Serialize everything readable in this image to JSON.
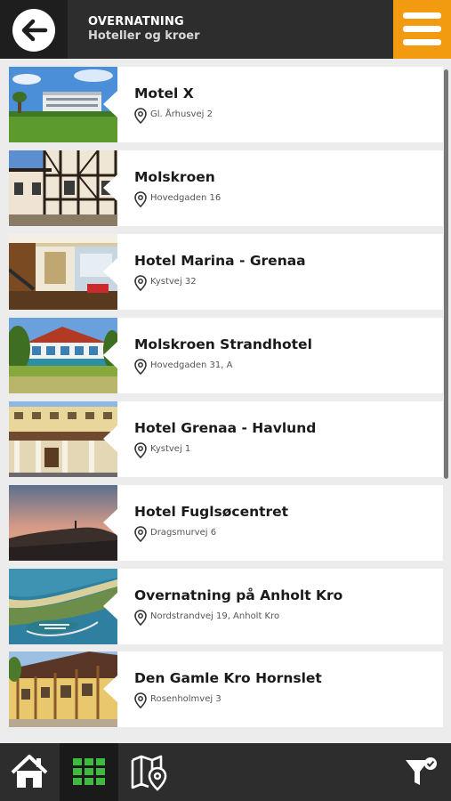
{
  "header": {
    "title": "OVERNATNING",
    "subtitle": "Hoteller og kroer",
    "back_icon": "arrow-left-icon",
    "menu_icon": "hamburger-menu-icon",
    "accent_color": "#f29b10"
  },
  "hotels": [
    {
      "name": "Motel X",
      "address": "Gl. Århusvej 2"
    },
    {
      "name": "Molskroen",
      "address": "Hovedgaden 16"
    },
    {
      "name": "Hotel Marina - Grenaa",
      "address": "Kystvej 32"
    },
    {
      "name": "Molskroen Strandhotel",
      "address": "Hovedgaden 31, A"
    },
    {
      "name": "Hotel Grenaa - Havlund",
      "address": "Kystvej 1"
    },
    {
      "name": "Hotel Fuglsøcentret",
      "address": "Dragsmurvej 6"
    },
    {
      "name": "Overnatning på Anholt Kro",
      "address": "Nordstrandvej 19, Anholt Kro"
    },
    {
      "name": "Den Gamle Kro Hornslet",
      "address": "Rosenholmvej 3"
    }
  ],
  "bottom_nav": {
    "items": [
      {
        "icon": "home-icon",
        "active": false
      },
      {
        "icon": "grid-icon",
        "active": true,
        "color": "#3fb93f"
      },
      {
        "icon": "map-pin-icon",
        "active": false
      },
      {
        "icon": "filter-icon",
        "active": false
      }
    ]
  }
}
